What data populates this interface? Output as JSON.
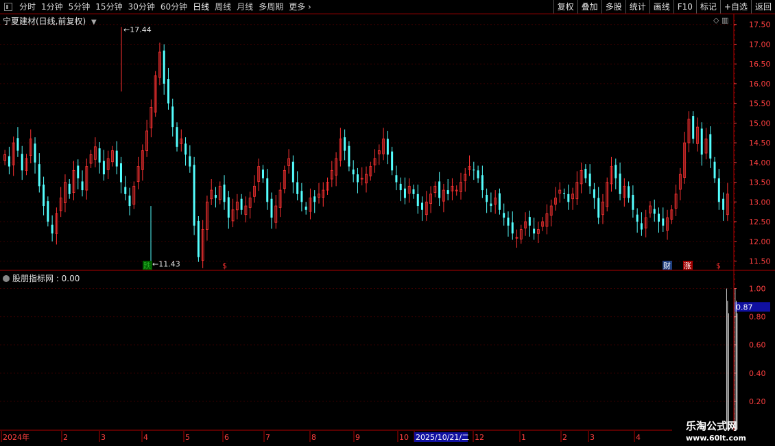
{
  "toolbar": {
    "periods": [
      "分时",
      "1分钟",
      "5分钟",
      "15分钟",
      "30分钟",
      "60分钟",
      "日线",
      "周线",
      "月线",
      "多周期",
      "更多"
    ],
    "active_period": "日线",
    "buttons": [
      "复权",
      "叠加",
      "多股",
      "统计",
      "画线",
      "F10",
      "标记",
      "+自选",
      "返回"
    ]
  },
  "chart_header": {
    "title": "宁夏建材(日线,前复权)"
  },
  "indicator_header": {
    "title": "股朋指标网 : 0.00"
  },
  "markers": {
    "high_label": "17.44",
    "low_label": "11.43",
    "tags": [
      {
        "text": "跌",
        "color": "#22aa22",
        "bg": "#006000"
      },
      {
        "text": "$",
        "color": "#ff3030",
        "bg": "none"
      },
      {
        "text": "财",
        "color": "#ffffff",
        "bg": "#204080"
      },
      {
        "text": "涨",
        "color": "#ffffff",
        "bg": "#a00000"
      },
      {
        "text": "$",
        "color": "#ff3030",
        "bg": "none"
      }
    ]
  },
  "price_axis": [
    "17.50",
    "17.00",
    "16.50",
    "16.00",
    "15.50",
    "15.00",
    "14.50",
    "14.00",
    "13.50",
    "13.00",
    "12.50",
    "12.00",
    "11.50"
  ],
  "indicator_axis": [
    "1.00",
    "0.80",
    "0.60",
    "0.40",
    "0.20"
  ],
  "indicator_current": "0.87",
  "date_axis": [
    "2024年",
    "2",
    "3",
    "4",
    "5",
    "6",
    "7",
    "8",
    "9",
    "10",
    "2025/10/21/二",
    "12",
    "1",
    "2",
    "3",
    "4"
  ],
  "watermark": {
    "line1": "乐淘公式网",
    "line2": "www.60lt.com"
  },
  "colors": {
    "up": "#ff3232",
    "down": "#54ffff",
    "grid": "#3a0000",
    "axis": "#ff4040"
  },
  "chart_data": {
    "type": "candlestick",
    "title": "宁夏建材(日线,前复权)",
    "ylim": [
      11.3,
      17.6
    ],
    "high": 17.44,
    "low": 11.43,
    "closes": [
      14.2,
      13.9,
      14.5,
      14.3,
      13.8,
      14.1,
      14.6,
      14.0,
      13.4,
      12.9,
      12.5,
      12.2,
      12.7,
      13.1,
      13.5,
      13.2,
      13.8,
      13.6,
      13.3,
      13.9,
      14.2,
      14.4,
      14.0,
      13.7,
      14.1,
      14.3,
      13.9,
      13.5,
      13.2,
      12.9,
      13.4,
      13.9,
      14.3,
      14.8,
      15.4,
      16.2,
      16.8,
      16.0,
      15.5,
      14.9,
      14.4,
      14.6,
      14.2,
      13.9,
      12.4,
      11.6,
      12.3,
      13.0,
      13.3,
      13.1,
      13.4,
      13.0,
      12.6,
      12.8,
      13.0,
      12.8,
      12.9,
      13.1,
      13.4,
      13.9,
      13.6,
      13.0,
      12.6,
      12.9,
      13.3,
      13.8,
      14.1,
      13.5,
      13.2,
      13.0,
      12.8,
      13.1,
      13.0,
      13.2,
      13.3,
      13.5,
      13.8,
      14.1,
      14.6,
      14.3,
      13.9,
      13.7,
      13.5,
      13.6,
      13.7,
      13.9,
      14.1,
      14.3,
      14.6,
      14.2,
      13.8,
      13.5,
      13.3,
      13.1,
      13.4,
      13.2,
      12.9,
      12.8,
      13.0,
      13.2,
      13.4,
      13.1,
      13.3,
      13.2,
      13.4,
      13.3,
      13.5,
      13.7,
      13.9,
      13.8,
      13.6,
      13.3,
      13.0,
      12.9,
      13.1,
      12.8,
      12.6,
      12.4,
      12.2,
      12.1,
      12.3,
      12.5,
      12.4,
      12.2,
      12.3,
      12.5,
      12.7,
      12.9,
      13.1,
      13.3,
      13.2,
      13.0,
      13.2,
      13.5,
      13.8,
      13.6,
      13.4,
      13.1,
      12.6,
      13.0,
      13.5,
      13.9,
      13.6,
      13.2,
      13.4,
      13.1,
      12.8,
      12.5,
      12.3,
      12.6,
      12.9,
      12.7,
      12.5,
      12.4,
      12.6,
      12.8,
      13.2,
      13.7,
      14.5,
      15.1,
      14.6,
      14.9,
      14.2,
      14.6,
      14.1,
      13.6,
      13.0,
      12.8,
      13.2
    ]
  },
  "indicator_data": {
    "type": "line",
    "ylim": [
      0,
      1.1
    ],
    "spikes": [
      {
        "index": 168,
        "value": 1.0
      },
      {
        "index": 170,
        "value": 1.0
      }
    ]
  }
}
